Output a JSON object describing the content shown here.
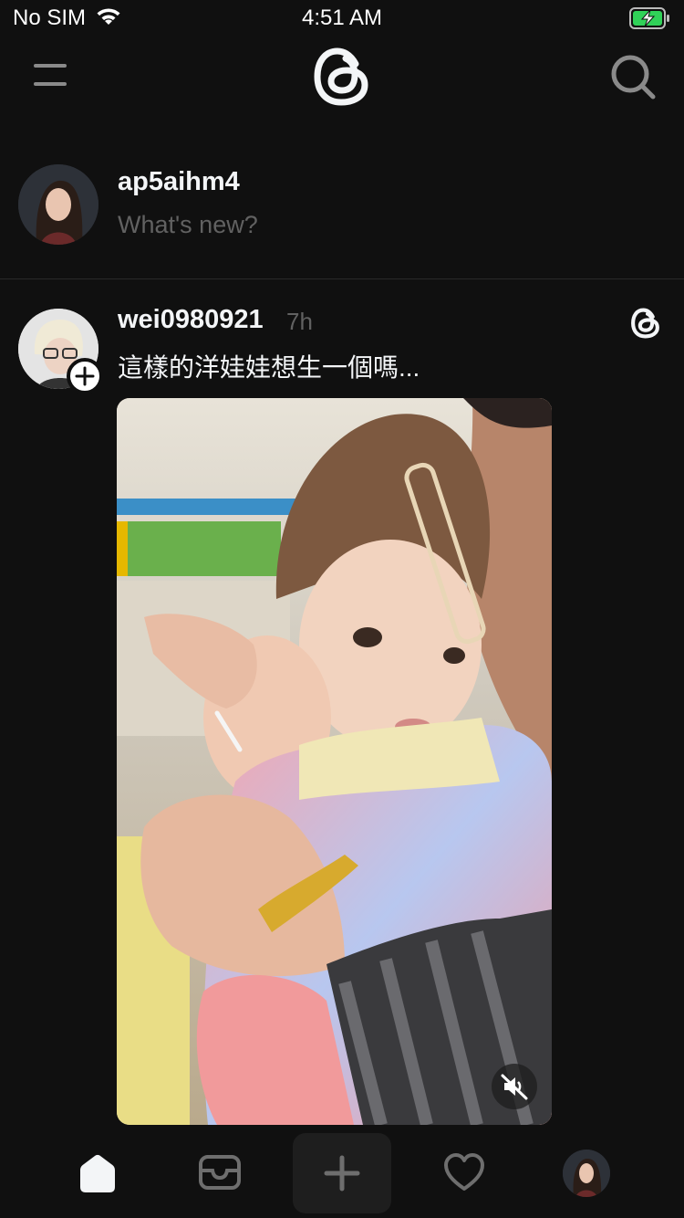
{
  "status_bar": {
    "carrier": "No SIM",
    "time": "4:51 AM",
    "battery_color": "#30d158"
  },
  "header": {
    "menu_icon": "hamburger-menu-icon",
    "logo_icon": "threads-logo-icon",
    "search_icon": "search-icon"
  },
  "composer": {
    "username": "ap5aihm4",
    "prompt": "What's new?"
  },
  "post": {
    "username": "wei0980921",
    "time": "7h",
    "text": "這樣的洋娃娃想生一個嗎...",
    "follow_icon": "plus-icon",
    "threads_icon": "threads-logo-icon",
    "mute_icon": "speaker-muted-icon"
  },
  "tabbar": {
    "items": [
      "home-icon",
      "inbox-icon",
      "plus-icon",
      "heart-icon",
      "profile-avatar"
    ]
  }
}
